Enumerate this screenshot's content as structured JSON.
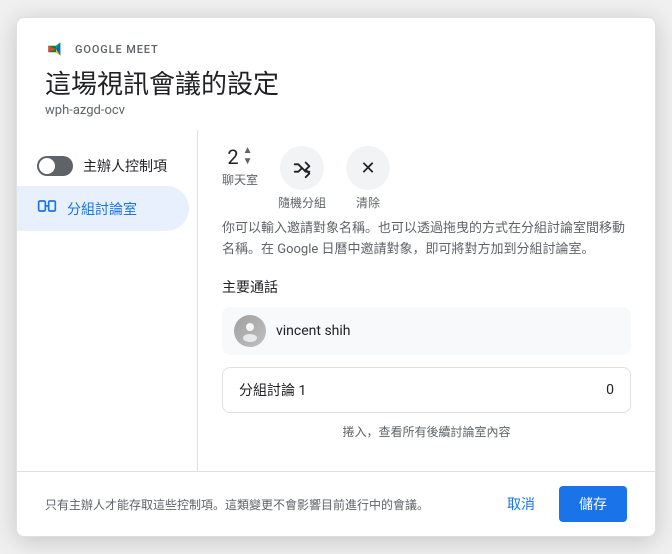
{
  "app": {
    "brand": "GOOGLE MEET",
    "title": "這場視訊會議的設定",
    "meeting_code": "wph-azgd-ocv"
  },
  "sidebar": {
    "toggle_label": "主辦人控制項",
    "breakout_label": "分組討論室"
  },
  "controls": {
    "number_value": "2",
    "chat_label": "聊天室",
    "random_label": "隨機分組",
    "clear_label": "清除"
  },
  "main": {
    "description": "你可以輸入邀請對象名稱。也可以透過拖曳的方式在分組討論室間移動名稱。在 Google 日曆中邀請對象，即可將對方加到分組討論室。",
    "section_title": "主要通話",
    "participant_name": "vincent shih",
    "breakout_room_name": "分組討論 1",
    "breakout_room_count": "0",
    "more_rooms_text": "捲入，查看所有後續討論室內容"
  },
  "footer": {
    "note": "只有主辦人才能存取這些控制項。這類變更不會影響目前進行中的會議。",
    "cancel_label": "取消",
    "save_label": "儲存"
  },
  "icons": {
    "expand": "⤢",
    "clear": "✕",
    "up_arrow": "▲",
    "down_arrow": "▼",
    "person": "👤"
  }
}
